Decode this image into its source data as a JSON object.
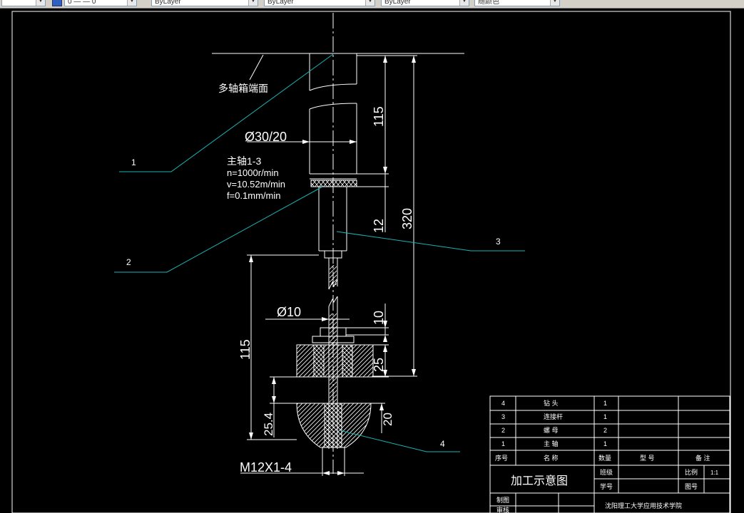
{
  "toolbar": {
    "layer_select": "0 — — 0",
    "color_select": "ByLayer",
    "linetype_select": "ByLayer",
    "lineweight_select": "ByLayer",
    "plotstyle_select": "随颜色"
  },
  "drawing": {
    "leader_labels": {
      "one": "1",
      "two": "2",
      "three": "3",
      "four": "4"
    },
    "headstock_face": "多轴箱端面",
    "spindle_title": "主轴1-3",
    "spindle_n": "n=1000r/min",
    "spindle_v": "v=10.52m/min",
    "spindle_f": "f=0.1mm/min",
    "dims": {
      "dia_upper": "Ø30/20",
      "dia_lower": "Ø10",
      "d115_upper": "115",
      "d12": "12",
      "d320": "320",
      "d115_lower": "115",
      "d10": "10",
      "d25": "25",
      "d25_4": "25.4",
      "d20": "20",
      "thread": "M12X1-4"
    }
  },
  "title_block": {
    "bom_rows": [
      {
        "no": "4",
        "name": "钻  头",
        "qty": "1"
      },
      {
        "no": "3",
        "name": "连接杆",
        "qty": "1"
      },
      {
        "no": "2",
        "name": "螺  母",
        "qty": "2"
      },
      {
        "no": "1",
        "name": "主  轴",
        "qty": "1"
      }
    ],
    "header": {
      "no": "序号",
      "name": "名  称",
      "qty": "数量",
      "model": "型  号",
      "remark": "备  注"
    },
    "drawing_title": "加工示意图",
    "class_label": "班级",
    "student_no_label": "学号",
    "scale_label": "比例",
    "scale_value": "1:1",
    "drawing_no_label": "图号",
    "drawn_label": "制图",
    "reviewed_label": "审核",
    "school": "沈阳理工大学应用技术学院"
  }
}
